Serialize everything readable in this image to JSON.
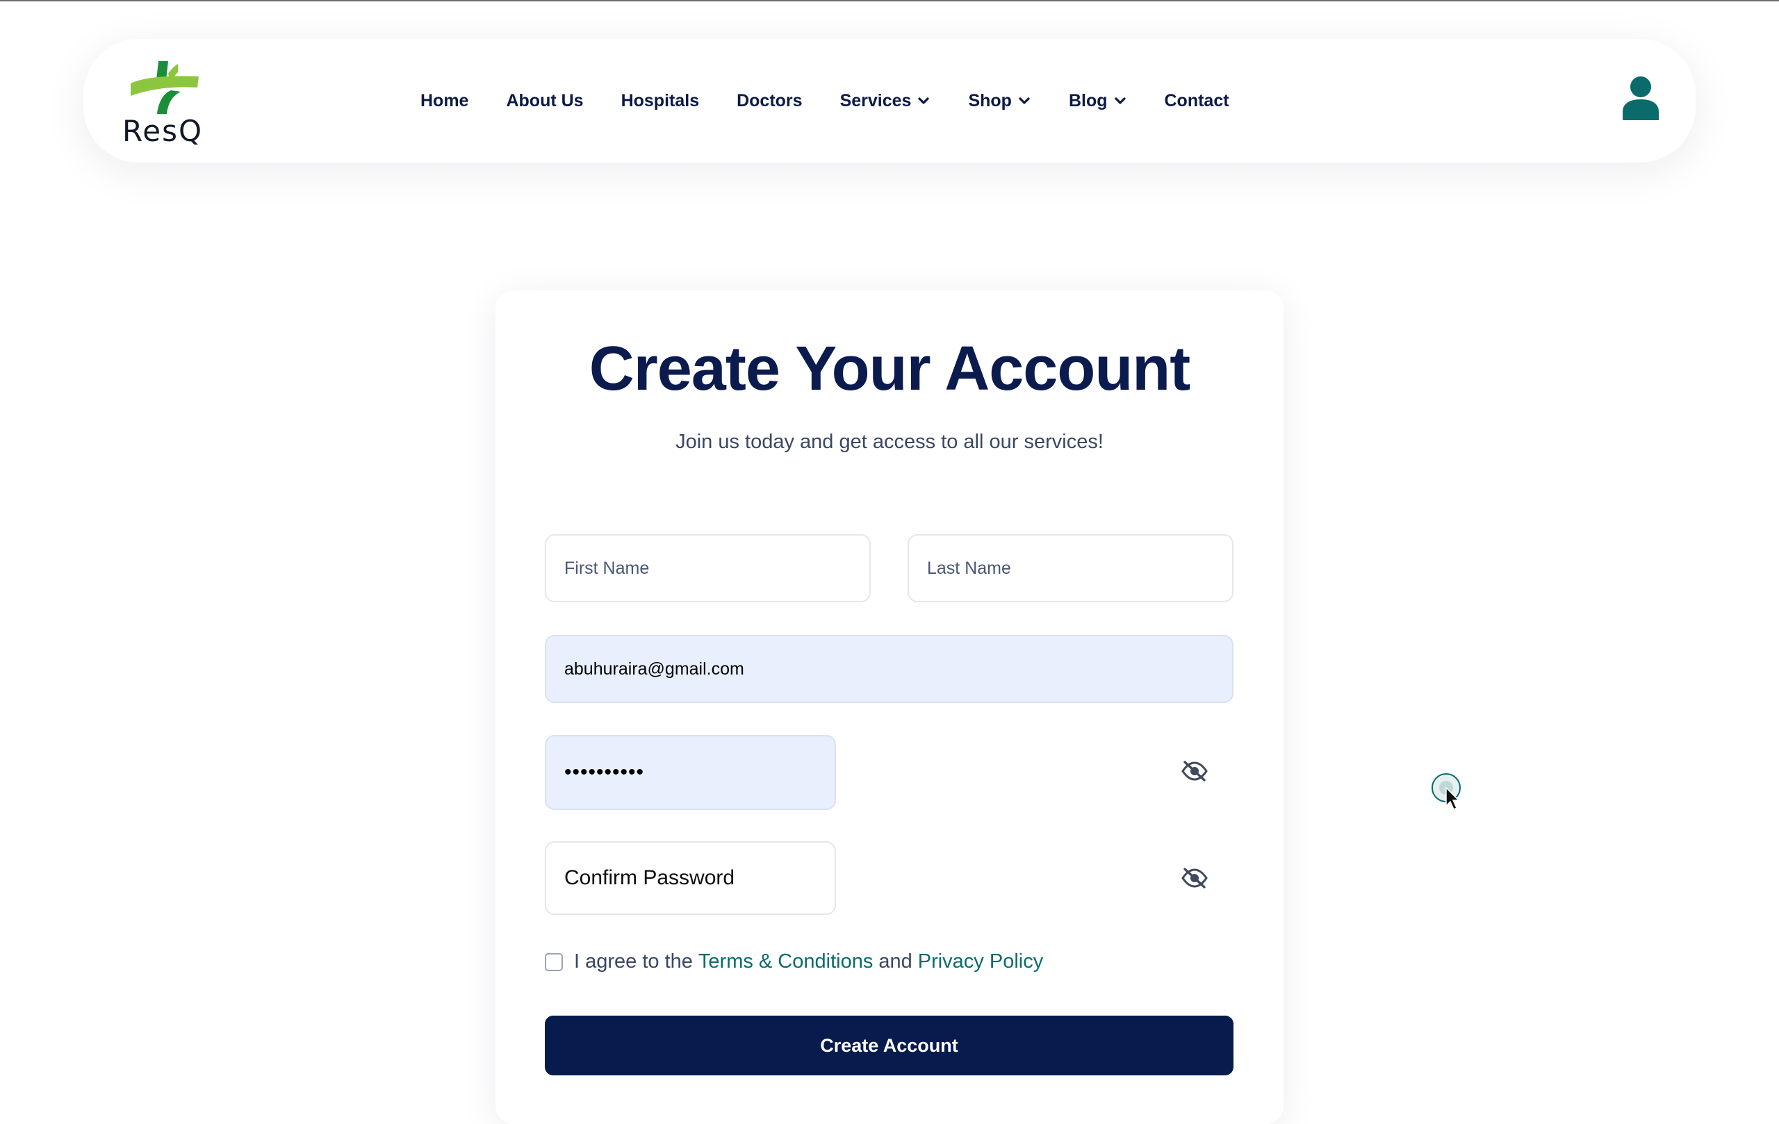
{
  "brand": {
    "name": "ResQ",
    "colors": {
      "logo_light": "#8cc63f",
      "logo_dark": "#1a8f3a",
      "accent": "#0b6b6b",
      "navy": "#071b4d"
    }
  },
  "nav": {
    "items": [
      {
        "label": "Home",
        "dropdown": false
      },
      {
        "label": "About Us",
        "dropdown": false
      },
      {
        "label": "Hospitals",
        "dropdown": false
      },
      {
        "label": "Doctors",
        "dropdown": false
      },
      {
        "label": "Services",
        "dropdown": true
      },
      {
        "label": "Shop",
        "dropdown": true
      },
      {
        "label": "Blog",
        "dropdown": true
      },
      {
        "label": "Contact",
        "dropdown": false
      }
    ],
    "account_icon": "user-icon"
  },
  "signup": {
    "title": "Create Your Account",
    "subtitle": "Join us today and get access to all our services!",
    "first_name_placeholder": "First Name",
    "last_name_placeholder": "Last Name",
    "email_value": "abuhuraira@gmail.com",
    "password_value": "••••••••••",
    "confirm_placeholder": "Confirm Password",
    "agree_prefix": "I agree to the",
    "terms_link": "Terms & Conditions",
    "agree_and": "and",
    "privacy_link": "Privacy Policy",
    "submit_label": "Create Account",
    "eye_icon": "eye-slash-icon"
  }
}
